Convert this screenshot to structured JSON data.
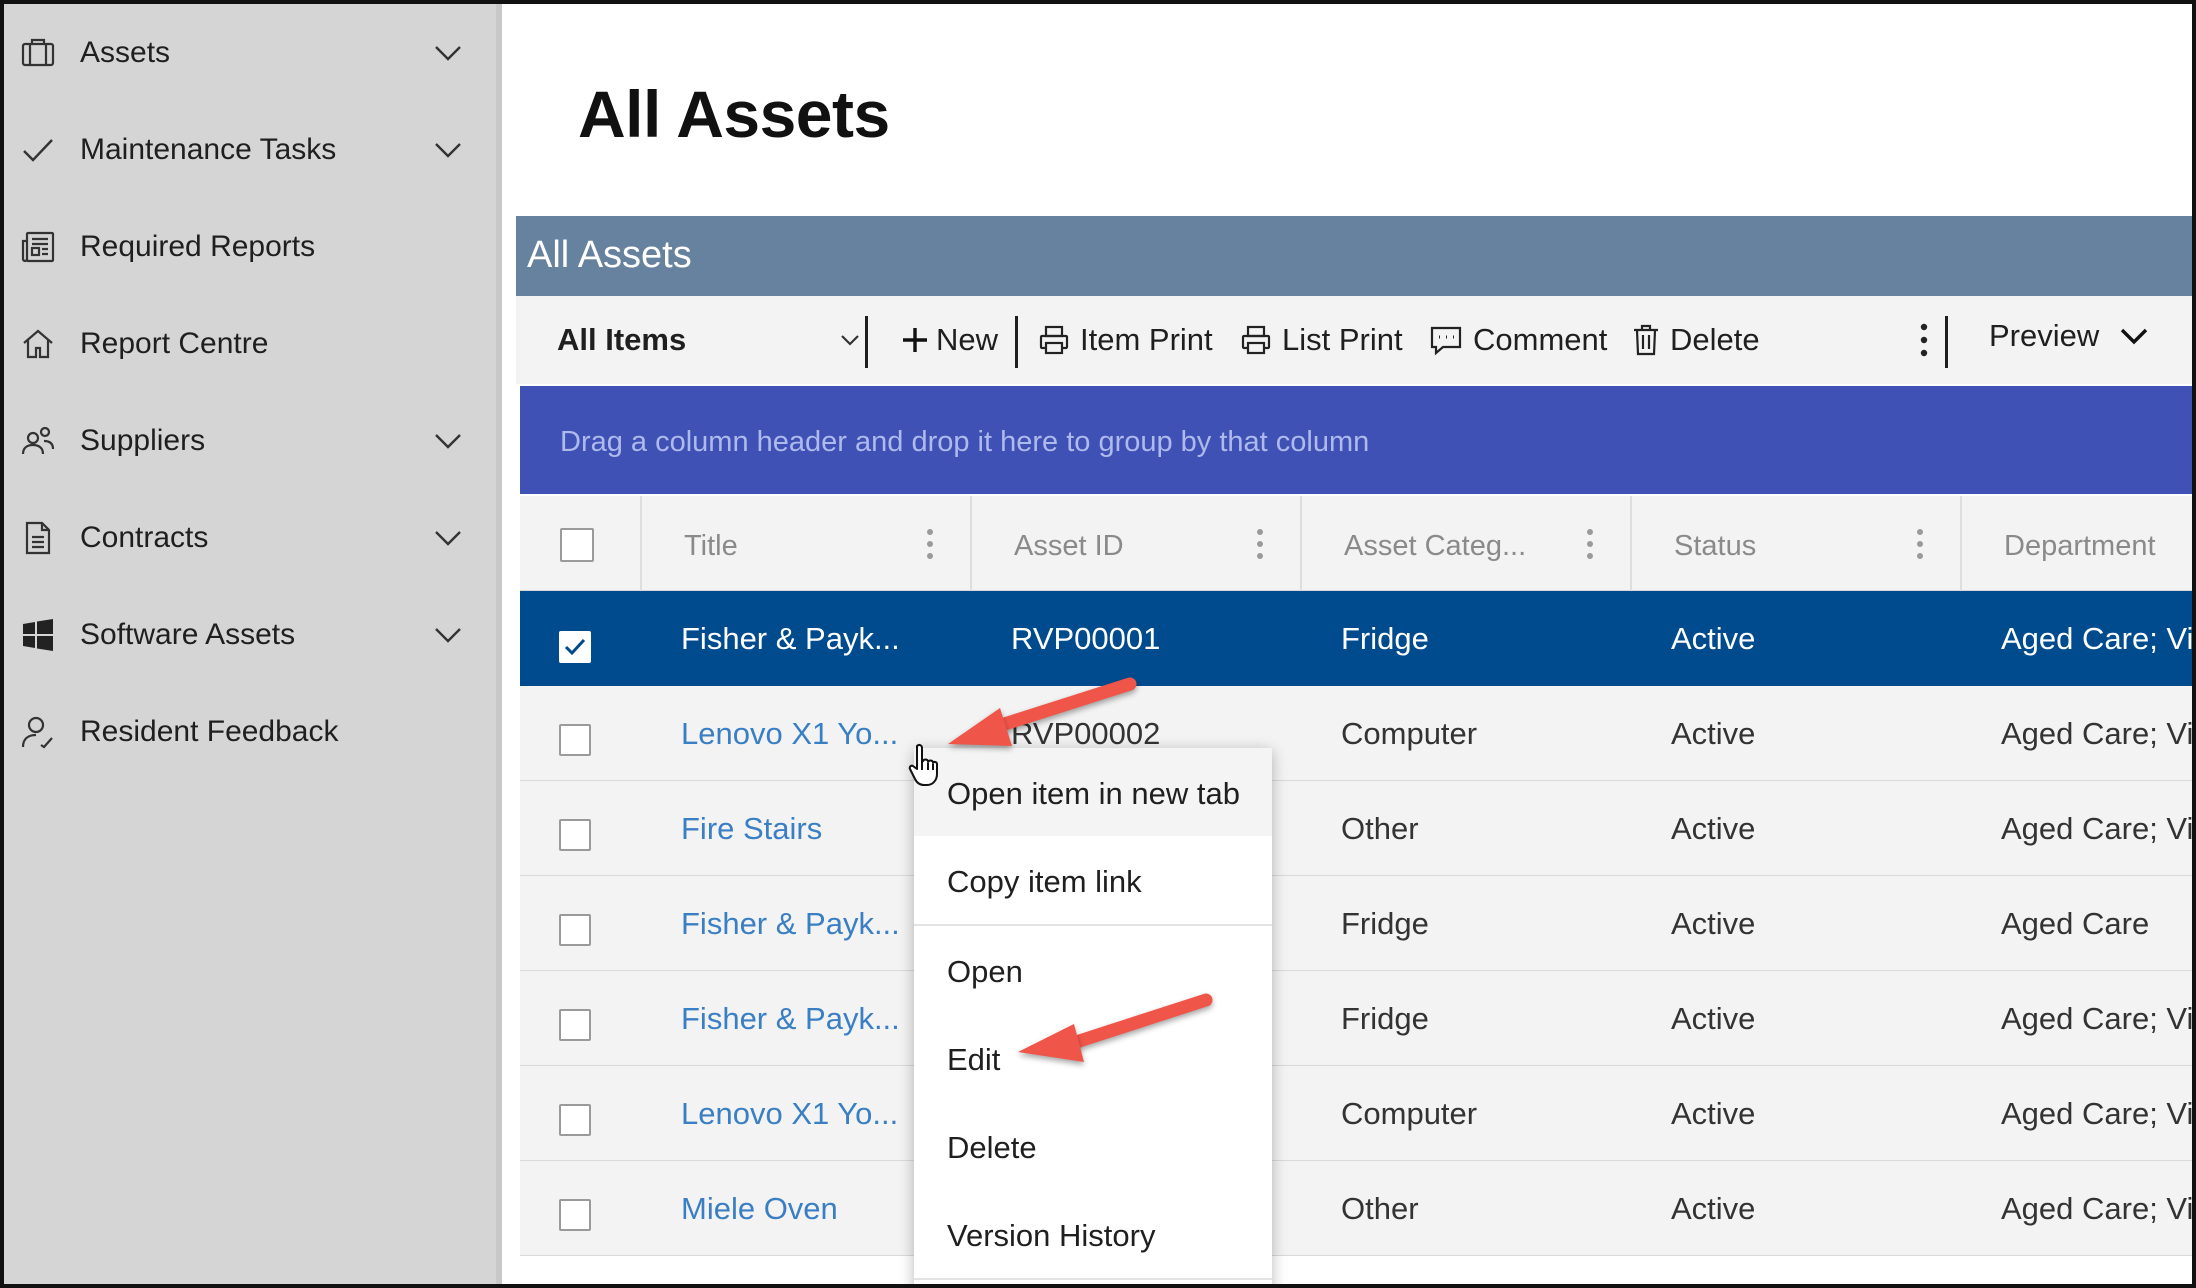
{
  "sidebar": {
    "items": [
      {
        "label": "Assets",
        "icon": "briefcase-icon",
        "expandable": true
      },
      {
        "label": "Maintenance Tasks",
        "icon": "checkmark-icon",
        "expandable": true
      },
      {
        "label": "Required Reports",
        "icon": "newspaper-icon",
        "expandable": false
      },
      {
        "label": "Report Centre",
        "icon": "home-icon",
        "expandable": false
      },
      {
        "label": "Suppliers",
        "icon": "people-icon",
        "expandable": true
      },
      {
        "label": "Contracts",
        "icon": "document-icon",
        "expandable": true
      },
      {
        "label": "Software Assets",
        "icon": "windows-logo-icon",
        "expandable": true
      },
      {
        "label": "Resident Feedback",
        "icon": "person-feedback-icon",
        "expandable": false
      }
    ]
  },
  "page": {
    "title": "All Assets"
  },
  "list": {
    "header_title": "All Assets",
    "accent_header": "#66829e",
    "group_bar_color": "#3f51b5",
    "selected_row_color": "#004b8d"
  },
  "toolbar": {
    "view": "All Items",
    "new_label": "New",
    "item_print_label": "Item Print",
    "list_print_label": "List Print",
    "comment_label": "Comment",
    "delete_label": "Delete",
    "preview_label": "Preview"
  },
  "grid": {
    "group_hint": "Drag a column header and drop it here to group by that column",
    "columns": [
      "Title",
      "Asset ID",
      "Asset Categ...",
      "Status",
      "Department"
    ],
    "rows": [
      {
        "title": "Fisher & Payk...",
        "asset_id": "RVP00001",
        "category": "Fridge",
        "status": "Active",
        "department": "Aged Care; Vi",
        "selected": true
      },
      {
        "title": "Lenovo X1 Yo...",
        "asset_id": "RVP00002",
        "category": "Computer",
        "status": "Active",
        "department": "Aged Care; Vi",
        "selected": false
      },
      {
        "title": "Fire Stairs",
        "asset_id": "",
        "category": "Other",
        "status": "Active",
        "department": "Aged Care; Vi",
        "selected": false
      },
      {
        "title": "Fisher & Payk...",
        "asset_id": "",
        "category": "Fridge",
        "status": "Active",
        "department": "Aged Care",
        "selected": false
      },
      {
        "title": "Fisher & Payk...",
        "asset_id": "",
        "category": "Fridge",
        "status": "Active",
        "department": "Aged Care; Vi",
        "selected": false
      },
      {
        "title": "Lenovo X1 Yo...",
        "asset_id": "",
        "category": "Computer",
        "status": "Active",
        "department": "Aged Care; Vi",
        "selected": false
      },
      {
        "title": "Miele Oven",
        "asset_id": "",
        "category": "Other",
        "status": "Active",
        "department": "Aged Care; Vi",
        "selected": false
      }
    ]
  },
  "context_menu": {
    "items": [
      "Open item in new tab",
      "Copy item link",
      "Open",
      "Edit",
      "Delete",
      "Version History"
    ]
  },
  "annotations": {
    "arrow_color": "#f0554a"
  }
}
